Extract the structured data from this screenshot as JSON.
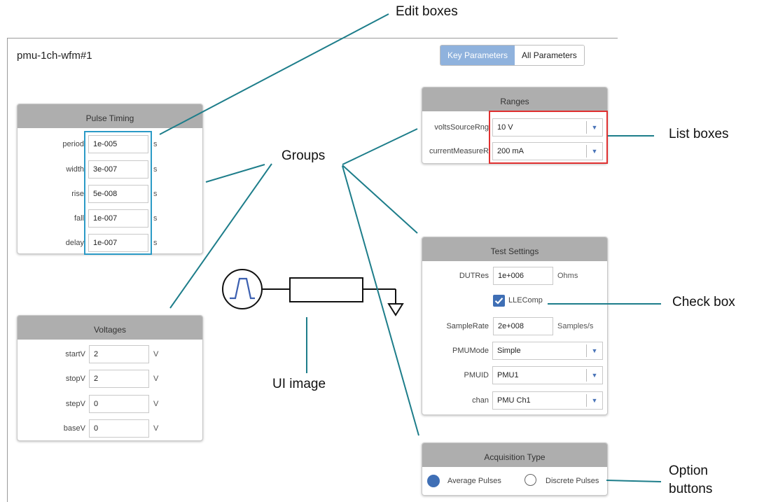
{
  "window": {
    "title": "pmu-1ch-wfm#1"
  },
  "view_toggle": {
    "key_label": "Key Parameters",
    "all_label": "All Parameters"
  },
  "pulse_timing": {
    "title": "Pulse Timing",
    "rows": [
      {
        "label": "period",
        "value": "1e-005",
        "unit": "s"
      },
      {
        "label": "width",
        "value": "3e-007",
        "unit": "s"
      },
      {
        "label": "rise",
        "value": "5e-008",
        "unit": "s"
      },
      {
        "label": "fall",
        "value": "1e-007",
        "unit": "s"
      },
      {
        "label": "delay",
        "value": "1e-007",
        "unit": "s"
      }
    ]
  },
  "voltages": {
    "title": "Voltages",
    "rows": [
      {
        "label": "startV",
        "value": "2",
        "unit": "V"
      },
      {
        "label": "stopV",
        "value": "2",
        "unit": "V"
      },
      {
        "label": "stepV",
        "value": "0",
        "unit": "V"
      },
      {
        "label": "baseV",
        "value": "0",
        "unit": "V"
      }
    ]
  },
  "ranges": {
    "title": "Ranges",
    "rows": [
      {
        "label": "voltsSourceRng",
        "value": "10 V"
      },
      {
        "label": "currentMeasureR",
        "value": "200 mA"
      }
    ]
  },
  "test_settings": {
    "title": "Test Settings",
    "dutres": {
      "label": "DUTRes",
      "value": "1e+006",
      "unit": "Ohms"
    },
    "llecomp": {
      "label": "LLEComp",
      "checked": true
    },
    "samplerate": {
      "label": "SampleRate",
      "value": "2e+008",
      "unit": "Samples/s"
    },
    "pmumode": {
      "label": "PMUMode",
      "value": "Simple"
    },
    "pmuid": {
      "label": "PMUID",
      "value": "PMU1"
    },
    "chan": {
      "label": "chan",
      "value": "PMU Ch1"
    }
  },
  "acquisition": {
    "title": "Acquisition Type",
    "options": [
      {
        "label": "Average Pulses",
        "selected": true
      },
      {
        "label": "Discrete Pulses",
        "selected": false
      }
    ]
  },
  "annotations": {
    "edit_boxes": "Edit boxes",
    "list_boxes": "List boxes",
    "groups": "Groups",
    "check_box": "Check box",
    "ui_image": "UI image",
    "option_line1": "Option",
    "option_line2": "buttons"
  },
  "colors": {
    "accent": "#2b9ac6",
    "highlight_red": "#e03030",
    "toggle_active": "#8fb2dd",
    "header_gray": "#aeaeae"
  }
}
